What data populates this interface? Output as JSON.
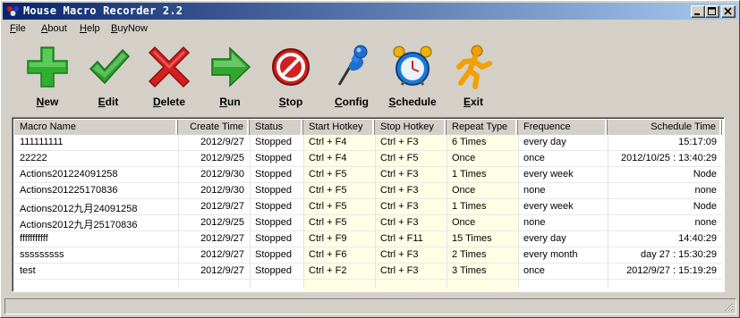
{
  "window": {
    "title": "Mouse Macro Recorder 2.2",
    "icon": "app-icon",
    "controls": [
      "minimize",
      "maximize",
      "close"
    ]
  },
  "menu": [
    {
      "label": "File"
    },
    {
      "label": "About"
    },
    {
      "label": "Help"
    },
    {
      "label": "BuyNow"
    }
  ],
  "toolbar": [
    {
      "label": "New",
      "icon": "plus-icon",
      "color": "#2fae2f"
    },
    {
      "label": "Edit",
      "icon": "checkmark-icon",
      "color": "#2f9d2f"
    },
    {
      "label": "Delete",
      "icon": "x-icon",
      "color": "#d42020"
    },
    {
      "label": "Run",
      "icon": "arrow-right-icon",
      "color": "#30a830"
    },
    {
      "label": "Stop",
      "icon": "stop-icon",
      "color": "#d02020"
    },
    {
      "label": "Config",
      "icon": "pin-icon",
      "color": "#1e6fd0"
    },
    {
      "label": "Schedule",
      "icon": "alarm-clock-icon",
      "color": "#1e78d8"
    },
    {
      "label": "Exit",
      "icon": "running-man-icon",
      "color": "#f2a000"
    }
  ],
  "table": {
    "columns": [
      {
        "label": "Macro Name"
      },
      {
        "label": "Create Time"
      },
      {
        "label": "Status"
      },
      {
        "label": "Start Hotkey"
      },
      {
        "label": "Stop Hotkey"
      },
      {
        "label": "Repeat Type"
      },
      {
        "label": "Frequence"
      },
      {
        "label": "Schedule Time"
      }
    ],
    "rows": [
      [
        "111111111",
        "2012/9/27",
        "Stopped",
        "Ctrl + F4",
        "Ctrl + F3",
        "6 Times",
        "every day",
        "15:17:09"
      ],
      [
        "22222",
        "2012/9/25",
        "Stopped",
        "Ctrl + F4",
        "Ctrl + F5",
        "Once",
        "once",
        "2012/10/25 : 13:40:29"
      ],
      [
        "Actions201224091258",
        "2012/9/30",
        "Stopped",
        "Ctrl + F5",
        "Ctrl + F3",
        "1 Times",
        "every week",
        "Node"
      ],
      [
        "Actions201225170836",
        "2012/9/30",
        "Stopped",
        "Ctrl + F5",
        "Ctrl + F3",
        "Once",
        "none",
        "none"
      ],
      [
        "Actions2012九月24091258",
        "2012/9/27",
        "Stopped",
        "Ctrl + F5",
        "Ctrl + F3",
        "1 Times",
        "every week",
        "Node"
      ],
      [
        "Actions2012九月25170836",
        "2012/9/25",
        "Stopped",
        "Ctrl + F5",
        "Ctrl + F3",
        "Once",
        "none",
        "none"
      ],
      [
        "fffffffffff",
        "2012/9/27",
        "Stopped",
        "Ctrl + F9",
        "Ctrl + F11",
        "15 Times",
        "every day",
        "14:40:29"
      ],
      [
        "sssssssss",
        "2012/9/27",
        "Stopped",
        "Ctrl + F6",
        "Ctrl + F3",
        "2 Times",
        "every month",
        "day 27 : 15:30:29"
      ],
      [
        "test",
        "2012/9/27",
        "Stopped",
        "Ctrl + F2",
        "Ctrl + F3",
        "3 Times",
        "once",
        "2012/9/27 : 15:19:29"
      ]
    ],
    "highlight_color": "#ffffe6"
  },
  "status_bar": {
    "text": ""
  }
}
